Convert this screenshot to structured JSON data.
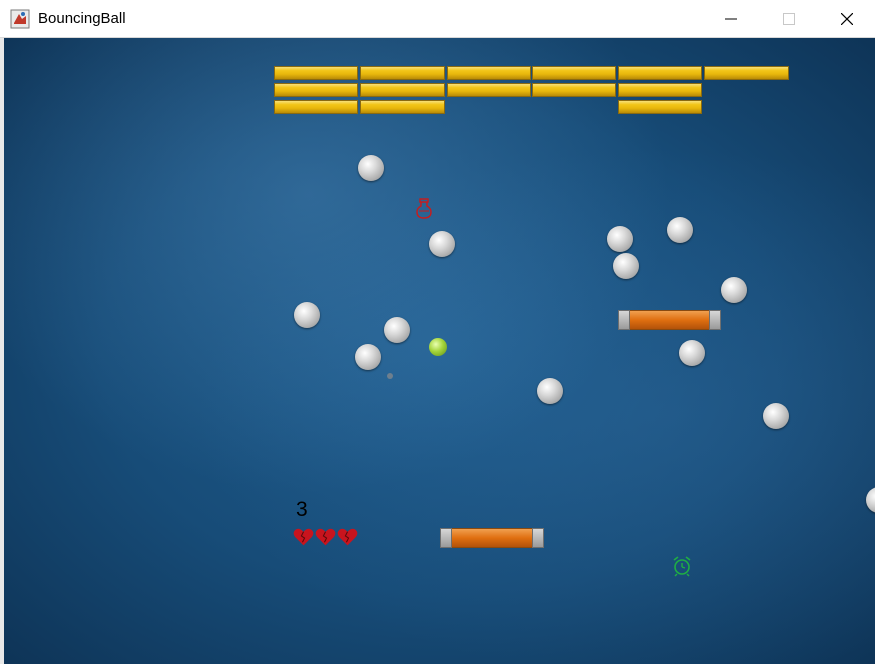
{
  "window": {
    "title": "BouncingBall",
    "app_icon": "java-app-icon",
    "controls": [
      "minimize-icon",
      "maximize-icon",
      "close-icon"
    ]
  },
  "game": {
    "score": "3",
    "lives": 3,
    "bricks": [
      {
        "row": 0,
        "col": 0
      },
      {
        "row": 0,
        "col": 1
      },
      {
        "row": 0,
        "col": 2
      },
      {
        "row": 0,
        "col": 3
      },
      {
        "row": 0,
        "col": 4
      },
      {
        "row": 0,
        "col": 5
      },
      {
        "row": 1,
        "col": 0
      },
      {
        "row": 1,
        "col": 1
      },
      {
        "row": 1,
        "col": 2
      },
      {
        "row": 1,
        "col": 3
      },
      {
        "row": 1,
        "col": 4
      },
      {
        "row": 2,
        "col": 0
      },
      {
        "row": 2,
        "col": 1
      },
      {
        "row": 2,
        "col": 4
      }
    ],
    "powerups": [
      {
        "icon": "potion-icon",
        "color": "#cc1a1a"
      },
      {
        "icon": "alarm-clock-icon",
        "color": "#1fae44"
      }
    ],
    "colors": {
      "background": "#1a5282",
      "brick": "#f2c518",
      "paddle": "#e06f10",
      "heart": "#c8141e",
      "ball": "#c8c8c8",
      "active_ball": "#a4d43a"
    }
  }
}
